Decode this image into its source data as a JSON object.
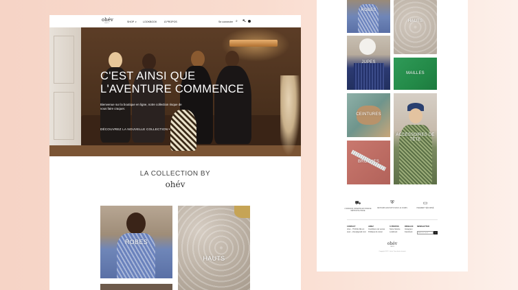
{
  "brand": {
    "logo": "ohév",
    "tagline": "PARIS"
  },
  "nav": {
    "items": [
      "SHOP",
      "LOOKBOOK",
      "À PROPOS"
    ],
    "login": "Se connecter",
    "cart_count": "0"
  },
  "hero": {
    "title_line1": "C'EST AINSI QUE",
    "title_line2": "L'AVENTURE COMMENCE",
    "subtitle": "Bienvenue sur la boutique en ligne, notre collection risque de vous faire craquer.",
    "cta": "DÉCOUVREZ LA NOUVELLE COLLECTION"
  },
  "collection": {
    "title": "LA COLLECTION BY",
    "brand": "ohév",
    "tiles": [
      "ROBES",
      "HAUTS"
    ]
  },
  "right_grid": {
    "tiles": [
      "ROBES",
      "HAUTS",
      "JUPES",
      "MAILLES",
      "CEINTURES",
      "ACCESSOIRES DE TÊTE",
      "BROCHES"
    ]
  },
  "features": [
    {
      "icon": "truck-icon",
      "text": "LIVRAISON OFFERTE EN FRANCE MÉTROPOLITAINE"
    },
    {
      "icon": "shield-icon",
      "text": "RETOURS GRATUITS SOUS 14 JOURS"
    },
    {
      "icon": "card-icon",
      "text": "PAIEMENT SÉCURISÉ"
    }
  ],
  "footer": {
    "columns": [
      {
        "head": "CONTACT",
        "lines": [
          "ohev - 75 RUE DE LA",
          "avec - ohev@gmail.com"
        ]
      },
      {
        "head": "AIDEZ",
        "lines": [
          "Conditions de ventes",
          "Politique de retour"
        ]
      },
      {
        "head": "À PROPOS",
        "lines": [
          "Notre histoire",
          "Lookbook"
        ]
      },
      {
        "head": "RÉSEAUX",
        "lines": [
          "Instagram",
          "Facebook"
        ]
      },
      {
        "head": "NEWSLETTER",
        "lines": []
      }
    ],
    "newsletter_placeholder": "Adresse email",
    "newsletter_button": "→",
    "logo": "ohév",
    "logo_sub": "PARIS",
    "copyright": "Copyright 2021 © ohév. Tous droits réservés"
  }
}
